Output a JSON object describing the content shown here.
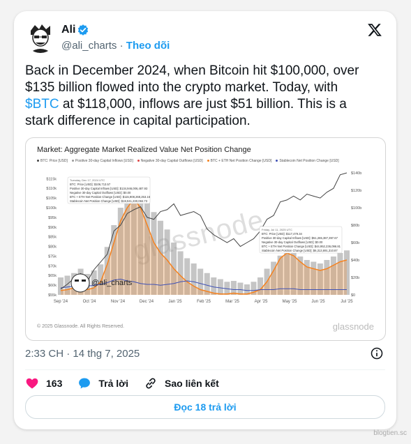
{
  "author": {
    "name": "Ali",
    "handle": "@ali_charts",
    "follow_label": "Theo dõi"
  },
  "tweet": {
    "text_before": "Back in December 2024, when Bitcoin hit $100,000, over $135 billion flowed into the crypto market. Today, with ",
    "cashtag": "$BTC",
    "text_after": " at $118,000, inflows are just $51 billion. This is a stark difference in capital participation."
  },
  "chart_data": {
    "type": "area",
    "title": "Market: Aggregate Market Realized Value Net Position Change",
    "legend": [
      "BTC: Price [USD]",
      "Positive 30-day Capital Inflows [USD]",
      "Negative 30-day Capital Outflows [USD]",
      "BTC + ETH Net Position Change [USD]",
      "Stablecoin Net Position Change [USD]"
    ],
    "x_ticks": [
      "Sep '24",
      "Oct '24",
      "Nov '24",
      "Dec '24",
      "Jan '25",
      "Feb '25",
      "Mar '25",
      "Apr '25",
      "May '25",
      "Jun '25",
      "Jul '25"
    ],
    "y_left_ticks": [
      "$55k",
      "$60k",
      "$65k",
      "$70k",
      "$75k",
      "$80k",
      "$85k",
      "$90k",
      "$95k",
      "$100k",
      "$105k",
      "$110k",
      "$115k"
    ],
    "y_right_ticks": [
      "$0",
      "$20b",
      "$40b",
      "$60b",
      "$80b",
      "$100b",
      "$120b",
      "$140b"
    ],
    "ylim_left": [
      55000,
      118000
    ],
    "ylim_right": [
      0,
      140
    ],
    "series": [
      {
        "name": "BTC: Price [USD]",
        "color": "#444444",
        "values": [
          58000,
          60500,
          63500,
          66000,
          62000,
          68000,
          72000,
          76000,
          88000,
          91000,
          97000,
          99000,
          100500,
          95000,
          94000,
          98000,
          99000,
          102000,
          96000,
          97000,
          98000,
          96000,
          89000,
          86000,
          84000,
          82000,
          84000,
          80000,
          82000,
          84000,
          88000,
          94000,
          96000,
          103000,
          104000,
          106000,
          104000,
          107000,
          106000,
          105000,
          108000,
          110000,
          117000,
          118000
        ]
      },
      {
        "name": "Positive 30-day Capital Inflows [USD]",
        "color": "#9a9a9a",
        "values": [
          20,
          22,
          25,
          30,
          24,
          28,
          35,
          55,
          80,
          100,
          120,
          135,
          128,
          110,
          95,
          85,
          75,
          60,
          50,
          42,
          36,
          30,
          25,
          20,
          18,
          15,
          16,
          14,
          12,
          15,
          20,
          30,
          38,
          45,
          50,
          48,
          44,
          40,
          38,
          36,
          40,
          44,
          48,
          51
        ]
      },
      {
        "name": "BTC + ETH Net Position Change [USD]",
        "color": "#f5821f",
        "values": [
          5,
          6,
          8,
          10,
          6,
          8,
          15,
          35,
          60,
          85,
          100,
          110,
          100,
          80,
          60,
          48,
          40,
          30,
          22,
          15,
          10,
          6,
          4,
          2,
          1,
          1,
          2,
          1,
          1,
          3,
          6,
          15,
          28,
          42,
          48,
          45,
          38,
          32,
          30,
          28,
          30,
          34,
          38,
          40
        ]
      },
      {
        "name": "Stablecoin Net Position Change [USD]",
        "color": "#3f51b5",
        "values": [
          8,
          9,
          10,
          12,
          10,
          11,
          12,
          14,
          17,
          18,
          16,
          15,
          13,
          12,
          12,
          11,
          12,
          13,
          15,
          16,
          15,
          13,
          11,
          9,
          8,
          7,
          6,
          6,
          5,
          5,
          6,
          6,
          6,
          7,
          7,
          7,
          6,
          6,
          6,
          6,
          6,
          6,
          6,
          6
        ]
      }
    ],
    "tooltip_dec": {
      "date": "Tuesday, Dec 17, 2024 UTC",
      "lines": [
        "BTC: Price [USD]: $106,713.57",
        "Positive 30-day Capital Inflows [USD]: $134,946,006,487.93",
        "Negative 30-day Capital Outflows [USD]: $0.00",
        "BTC + ETH Net Position Change [USD]: $115,908,268,253.16",
        "Stablecoin Net Position Change [USD]: $19,041,230,084.73"
      ]
    },
    "tooltip_jul": {
      "date": "Friday, Jul 11, 2025 UTC",
      "lines": [
        "BTC: Price [USD]: $117,479.34",
        "Positive 30-day Capital Inflows [USD]: $51,265,387,397.67",
        "Negative 30-day Capital Outflows [USD]: $0.00",
        "BTC + ETH Net Position Change [USD]: $44,952,236,096.81",
        "Stablecoin Net Position Change [USD]: $6,313,691,310.87"
      ]
    },
    "watermark": "glassnode",
    "footer": "© 2025 Glassnode. All Rights Reserved.",
    "brand": "glassnode",
    "overlay_handle": "@ali_charts"
  },
  "meta": {
    "time": "2:33 CH · 14 thg 7, 2025"
  },
  "actions": {
    "like_count": "163",
    "reply_label": "Trả lời",
    "copy_link_label": "Sao liên kết"
  },
  "read_replies_label": "Đọc 18 trả lời",
  "site_watermark": "blogtien.sc",
  "colors": {
    "accent": "#1d9bf0",
    "like": "#f91880",
    "btc_line": "#444444",
    "inflow": "#9a9a9a",
    "net_change": "#f5821f",
    "stablecoin": "#3f51b5"
  }
}
